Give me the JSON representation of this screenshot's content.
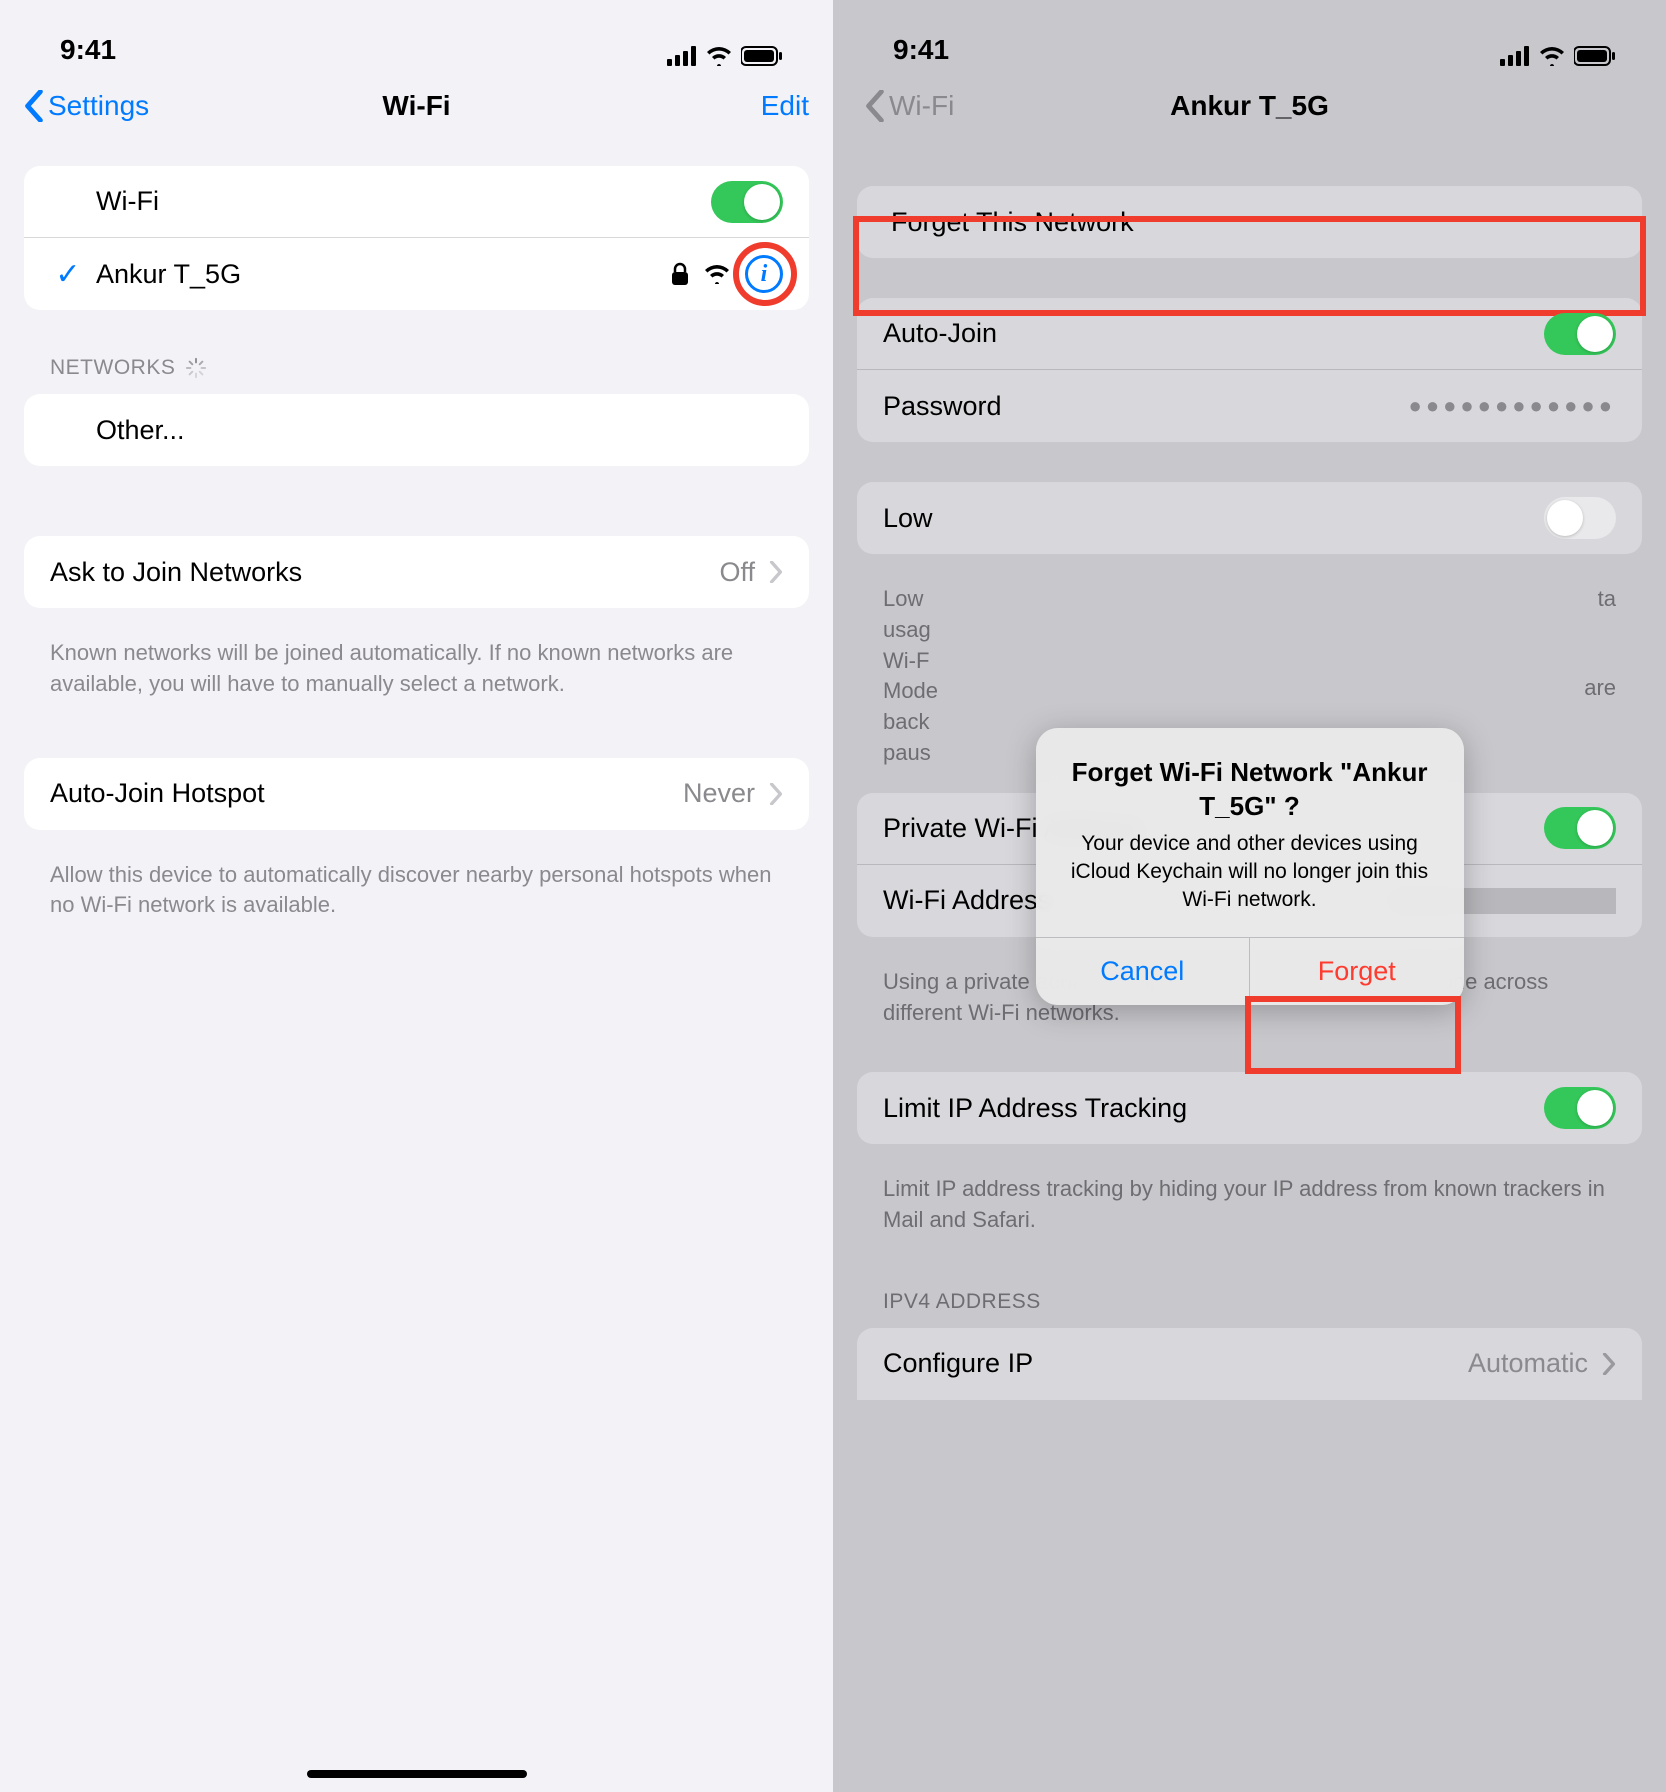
{
  "status": {
    "time": "9:41"
  },
  "left": {
    "nav": {
      "back": "Settings",
      "title": "Wi-Fi",
      "edit": "Edit"
    },
    "wifiRow": {
      "label": "Wi-Fi"
    },
    "connected": {
      "name": "Ankur T_5G"
    },
    "networksHeader": "NETWORKS",
    "otherRow": "Other...",
    "askJoin": {
      "label": "Ask to Join Networks",
      "value": "Off"
    },
    "askJoinFooter": "Known networks will be joined automatically. If no known networks are available, you will have to manually select a network.",
    "autoHotspot": {
      "label": "Auto-Join Hotspot",
      "value": "Never"
    },
    "autoHotspotFooter": "Allow this device to automatically discover nearby personal hotspots when no Wi-Fi network is available."
  },
  "right": {
    "nav": {
      "back": "Wi-Fi",
      "title": "Ankur T_5G"
    },
    "forgetRow": "Forget This Network",
    "autoJoin": "Auto-Join",
    "passwordLabel": "Password",
    "passwordValue": "●●●●●●●●●●●●",
    "lowDataLabel": "Low",
    "lowDataFooterLines": [
      "Low",
      "usag",
      "Wi-F",
      "Mode",
      "back",
      "paus"
    ],
    "lowDataFooterRight": [
      "ta",
      "are"
    ],
    "privateAddr": "Private Wi-Fi Address",
    "wifiAddr": "Wi-Fi Address",
    "privateFooter": "Using a private address helps reduce tracking of your iPhone across different Wi-Fi networks.",
    "limitIP": "Limit IP Address Tracking",
    "limitIPFooter": "Limit IP address tracking by hiding your IP address from known trackers in Mail and Safari.",
    "ipv4Header": "IPV4 ADDRESS",
    "configIP": {
      "label": "Configure IP",
      "value": "Automatic"
    },
    "alert": {
      "title": "Forget Wi-Fi Network \"Ankur T_5G\" ?",
      "message": "Your device and other devices using iCloud Keychain will no longer join this Wi-Fi network.",
      "cancel": "Cancel",
      "forget": "Forget"
    }
  }
}
